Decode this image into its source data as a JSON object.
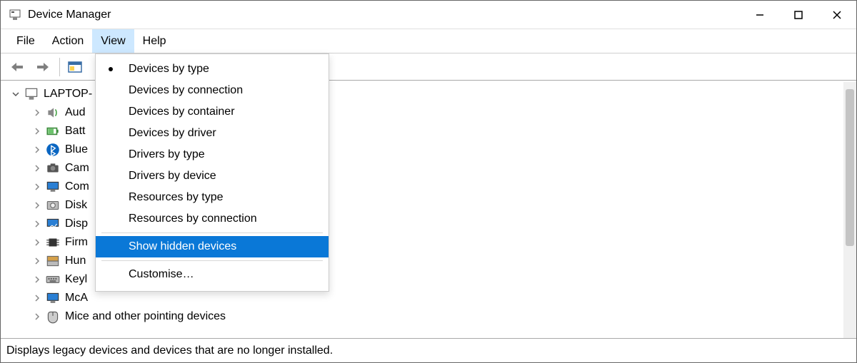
{
  "window": {
    "title": "Device Manager"
  },
  "menubar": {
    "file": "File",
    "action": "Action",
    "view": "View",
    "help": "Help"
  },
  "view_menu": {
    "devices_by_type": "Devices by type",
    "devices_by_connection": "Devices by connection",
    "devices_by_container": "Devices by container",
    "devices_by_driver": "Devices by driver",
    "drivers_by_type": "Drivers by type",
    "drivers_by_device": "Drivers by device",
    "resources_by_type": "Resources by type",
    "resources_by_connection": "Resources by connection",
    "show_hidden_devices": "Show hidden devices",
    "customise": "Customise…",
    "checked": "devices_by_type",
    "highlighted": "show_hidden_devices"
  },
  "tree": {
    "root": "LAPTOP-",
    "items": [
      {
        "label": "Aud",
        "icon": "speaker-icon"
      },
      {
        "label": "Batt",
        "icon": "battery-icon"
      },
      {
        "label": "Blue",
        "icon": "bluetooth-icon"
      },
      {
        "label": "Cam",
        "icon": "camera-icon"
      },
      {
        "label": "Com",
        "icon": "monitor-icon"
      },
      {
        "label": "Disk",
        "icon": "disk-icon"
      },
      {
        "label": "Disp",
        "icon": "display-adapter-icon"
      },
      {
        "label": "Firm",
        "icon": "chip-icon"
      },
      {
        "label": "Hun",
        "icon": "hid-icon"
      },
      {
        "label": "Keyl",
        "icon": "keyboard-icon"
      },
      {
        "label": "McA",
        "icon": "monitor-icon"
      },
      {
        "label": "Mice and other pointing devices",
        "icon": "mouse-icon"
      }
    ]
  },
  "statusbar": {
    "text": "Displays legacy devices and devices that are no longer installed."
  },
  "colors": {
    "highlight": "#0a78d7",
    "menu_open_bg": "#cde8ff"
  }
}
